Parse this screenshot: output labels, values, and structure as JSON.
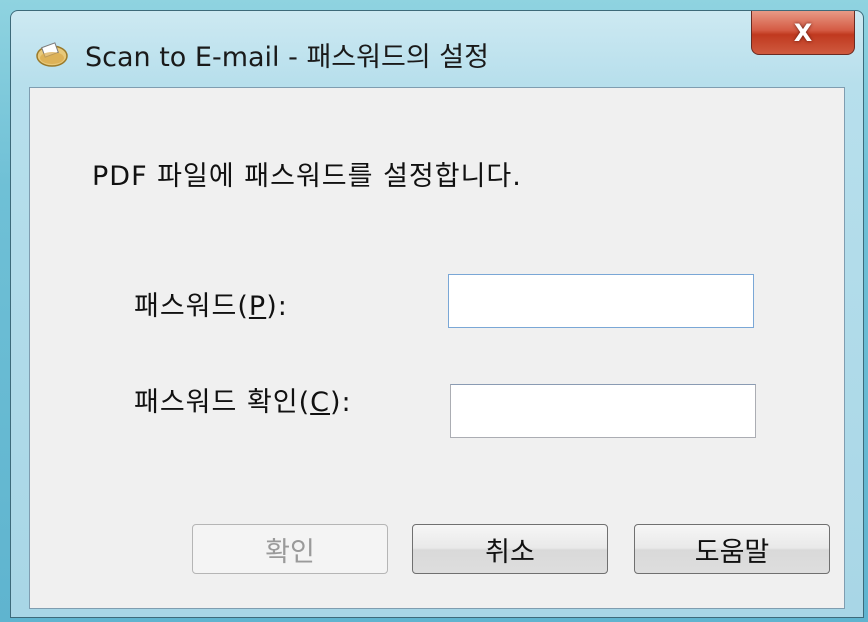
{
  "window": {
    "title": "Scan to E-mail - 패스워드의 설정",
    "close_glyph": "X",
    "app_icon": "scanner-app-icon"
  },
  "dialog": {
    "instruction": "PDF 파일에 패스워드를 설정합니다.",
    "password_label_prefix": "패스워드(",
    "password_label_key": "P",
    "password_label_suffix": "):",
    "password_value": "",
    "confirm_label_prefix": "패스워드 확인(",
    "confirm_label_key": "C",
    "confirm_label_suffix": "):",
    "confirm_value": ""
  },
  "buttons": {
    "ok_label": "확인",
    "ok_enabled": false,
    "cancel_label": "취소",
    "help_label": "도움말"
  }
}
